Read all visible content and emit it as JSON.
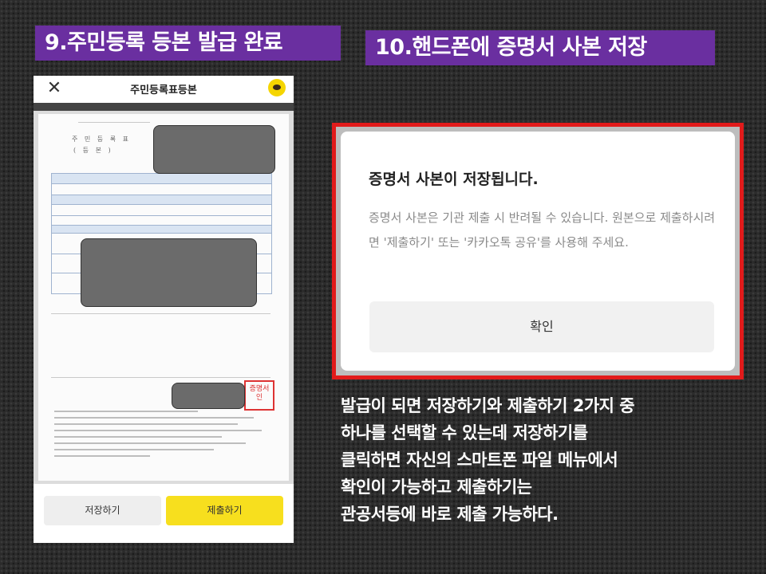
{
  "titles": {
    "step9": "9.주민등록 등본 발급 완료",
    "step10": "10.핸드폰에 증명서 사본 저장"
  },
  "phone": {
    "header_title": "주민등록표등본",
    "close_icon": "close-icon",
    "talk_icon": "kakaotalk-icon",
    "doc_heading": "주 민 등 록 표",
    "doc_subheading": "( 등   본 )",
    "seal_text": "증명서\n인",
    "save_button": "저장하기",
    "submit_button": "제출하기",
    "colors": {
      "submit": "#f7df1e",
      "save": "#eeeeee"
    }
  },
  "dialog": {
    "title": "증명서 사본이 저장됩니다.",
    "body": "증명서 사본은 기관 제출 시 반려될 수 있습니다. 원본으로 제출하시려면 '제출하기' 또는 '카카오톡 공유'를 사용해 주세요.",
    "confirm_button": "확인",
    "highlight_color": "#e21b1b"
  },
  "explanation": [
    "발급이 되면 저장하기와 제출하기 2가지 중",
    "하나를 선택할 수 있는데 저장하기를",
    "클릭하면  자신의 스마트폰 파일 메뉴에서",
    "확인이 가능하고 제출하기는",
    "관공서등에 바로 제출 가능하다."
  ],
  "accent_color": "#6a2fa0"
}
